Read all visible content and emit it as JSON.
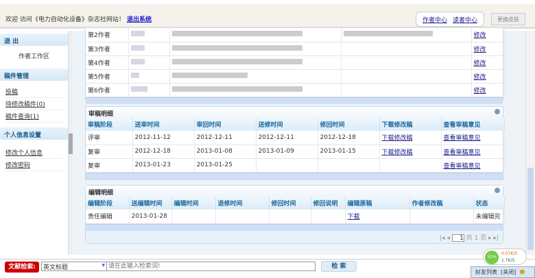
{
  "header": {
    "welcome": "欢迎     访问《电力自动化设备》杂志社网站！",
    "logout": "退出系统",
    "author_center": "作者中心",
    "reader_center": "读者中心",
    "skin": "更换皮肤"
  },
  "sidebar": {
    "exit": "退 出",
    "workspace": "作者工作区",
    "section1": "稿件管理",
    "items1": [
      "投稿",
      "待修改稿件(0)",
      "稿件查询(1)"
    ],
    "section2": "个人信息设置",
    "items2": [
      "修改个人信息",
      "修改密码"
    ]
  },
  "authors": {
    "rows": [
      "第2作者",
      "第3作者",
      "第4作者",
      "第5作者",
      "第6作者"
    ],
    "action": "修改"
  },
  "review": {
    "title": "审稿明细",
    "headers": [
      "审稿阶段",
      "送审时间",
      "审回时间",
      "送修时间",
      "修回时间",
      "下载修改稿",
      "查看审稿意见"
    ],
    "rows": [
      [
        "评审",
        "2012-11-12",
        "2012-12-11",
        "2012-12-11",
        "2012-12-18",
        "下载修改稿",
        "查看审稿意见"
      ],
      [
        "复审",
        "2012-12-18",
        "2013-01-08",
        "2013-01-09",
        "2013-01-15",
        "下载修改稿",
        "查看审稿意见"
      ],
      [
        "复审",
        "2013-01-23",
        "2013-01-25",
        "",
        "",
        "",
        "查看审稿意见"
      ]
    ]
  },
  "edit": {
    "title": "编辑明细",
    "headers": [
      "编辑阶段",
      "送编辑时间",
      "编辑时间",
      "退修时间",
      "修回时间",
      "修回说明",
      "编辑原稿",
      "作者修改稿",
      "状态"
    ],
    "rows": [
      [
        "责任编辑",
        "2013-01-28",
        "",
        "",
        "",
        "",
        "下载",
        "",
        "未编辑完"
      ]
    ],
    "page": "1",
    "total": "共 1 页"
  },
  "search": {
    "label": "文献检索:",
    "select": "英文标题",
    "placeholder": "请在此输入检索词!",
    "button": "检 索"
  },
  "tray": {
    "percent": "51%",
    "up": "0.07K/S",
    "down": "1.7K/S",
    "friends": "好友列表",
    "close": "[关闭]"
  }
}
